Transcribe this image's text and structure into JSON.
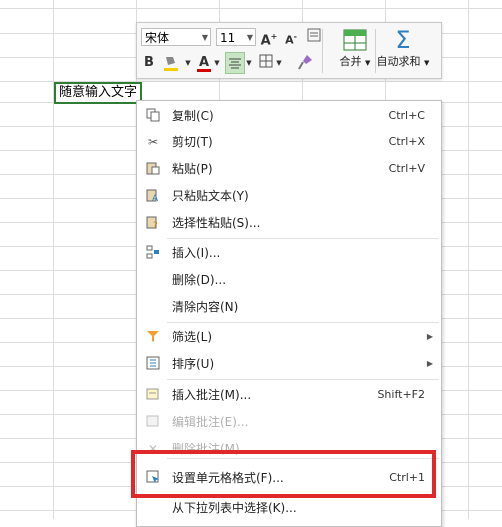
{
  "cell": {
    "text": "随意输入文字"
  },
  "toolbar": {
    "font_name": "宋体",
    "font_size": "11",
    "merge_label": "合并",
    "autosum_label": "自动求和",
    "icons": [
      "grow-font-icon",
      "shrink-font-icon",
      "wrap-icon",
      "bold-icon",
      "fill-color-icon",
      "font-color-icon",
      "align-center-icon",
      "border-icon",
      "format-painter-icon",
      "merge-icon",
      "autosum-icon"
    ]
  },
  "menu": {
    "copy": {
      "label": "复制(C)",
      "shortcut": "Ctrl+C"
    },
    "cut": {
      "label": "剪切(T)",
      "shortcut": "Ctrl+X"
    },
    "paste": {
      "label": "粘贴(P)",
      "shortcut": "Ctrl+V"
    },
    "paste_text": {
      "label": "只粘贴文本(Y)"
    },
    "paste_special": {
      "label": "选择性粘贴(S)..."
    },
    "insert": {
      "label": "插入(I)..."
    },
    "delete": {
      "label": "删除(D)..."
    },
    "clear": {
      "label": "清除内容(N)"
    },
    "filter": {
      "label": "筛选(L)"
    },
    "sort": {
      "label": "排序(U)"
    },
    "insert_comment": {
      "label": "插入批注(M)...",
      "shortcut": "Shift+F2"
    },
    "edit_comment": {
      "label": "编辑批注(E)..."
    },
    "delete_comment": {
      "label": "删除批注(M)"
    },
    "format_cells": {
      "label": "设置单元格格式(F)...",
      "shortcut": "Ctrl+1"
    },
    "pick_list": {
      "label": "从下拉列表中选择(K)..."
    }
  },
  "colors": {
    "highlight": "#e02828",
    "cell_border": "#2e7d32",
    "fill_yellow": "#f4d000",
    "font_red": "#d40000"
  }
}
